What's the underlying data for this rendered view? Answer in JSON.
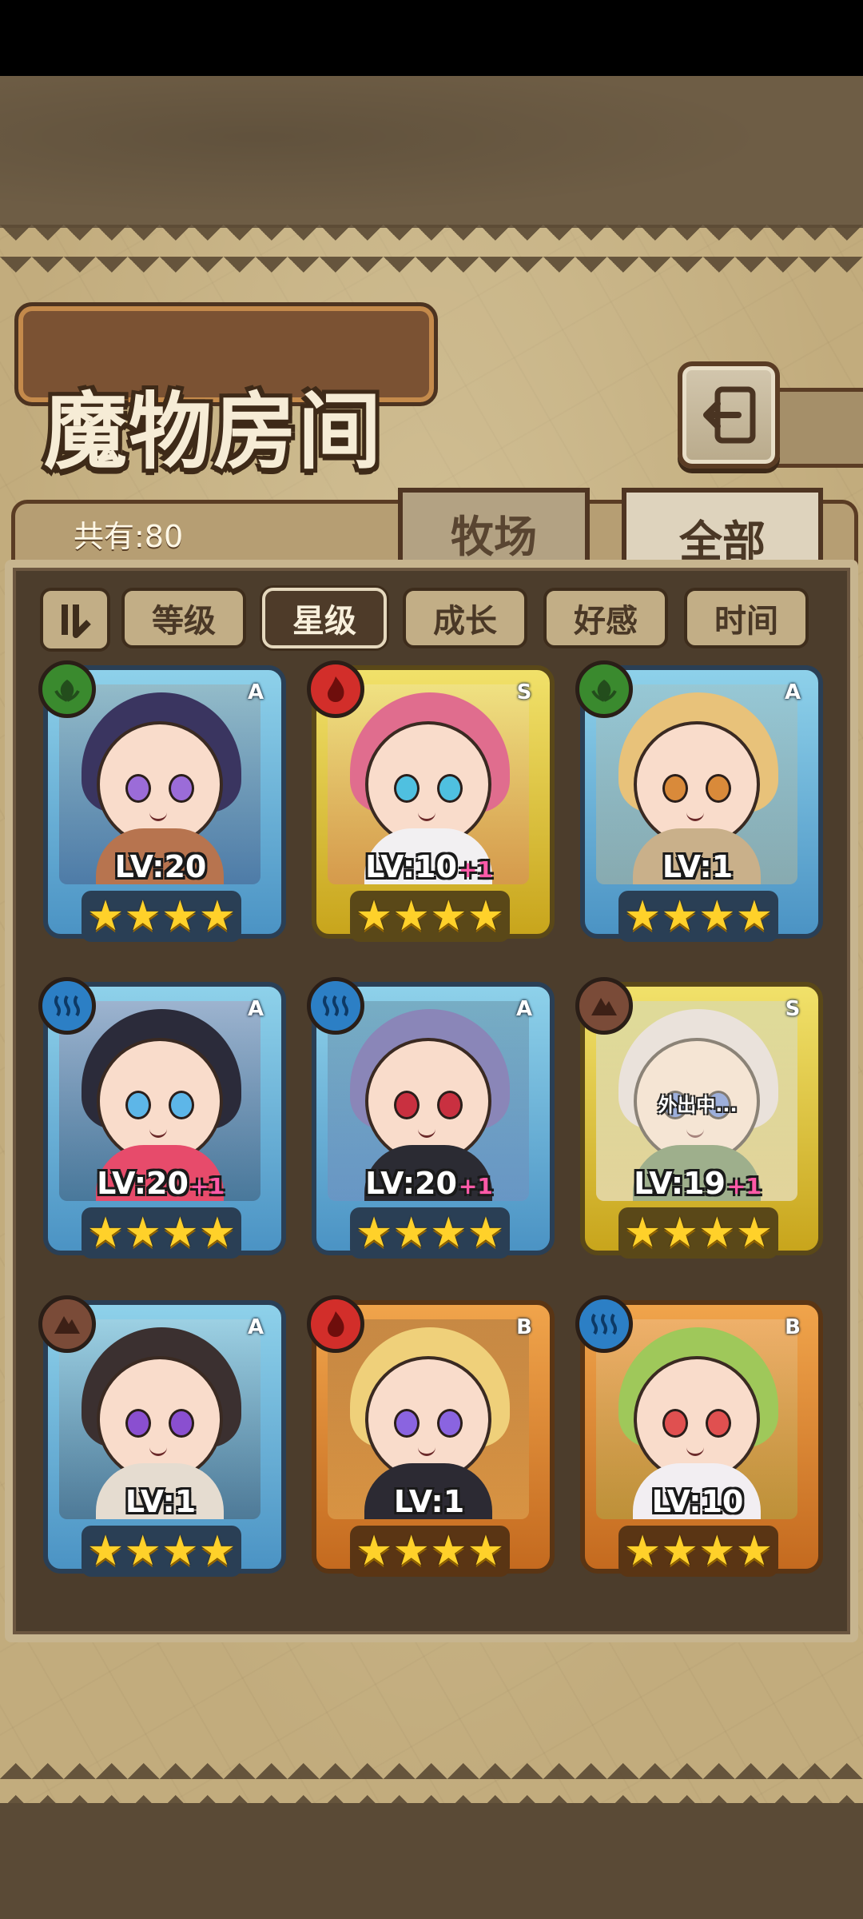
{
  "title": "魔物房间",
  "total_count": "共有:80",
  "tabs": [
    {
      "label": "牧场",
      "active": false
    },
    {
      "label": "全部",
      "active": true
    }
  ],
  "sort_buttons": [
    {
      "label": "等级",
      "active": false
    },
    {
      "label": "星级",
      "active": true
    },
    {
      "label": "成长",
      "active": false
    },
    {
      "label": "好感",
      "active": false
    },
    {
      "label": "时间",
      "active": false
    }
  ],
  "colors": {
    "tier_A": "#4b93c4",
    "tier_S": "#c8a51c",
    "tier_B": "#c46a1f",
    "star": "#ffd12a",
    "bonus_text": "#ff5aa8"
  },
  "monsters": [
    {
      "element": "leaf",
      "rank": "A",
      "level": "LV:20",
      "bonus": "",
      "stars": 4,
      "status": ""
    },
    {
      "element": "fire",
      "rank": "S",
      "level": "LV:10",
      "bonus": "+1",
      "stars": 4,
      "status": ""
    },
    {
      "element": "leaf",
      "rank": "A",
      "level": "LV:1",
      "bonus": "",
      "stars": 4,
      "status": ""
    },
    {
      "element": "water",
      "rank": "A",
      "level": "LV:20",
      "bonus": "+1",
      "stars": 4,
      "status": ""
    },
    {
      "element": "water",
      "rank": "A",
      "level": "LV:20",
      "bonus": "+1",
      "stars": 4,
      "status": ""
    },
    {
      "element": "rock",
      "rank": "S",
      "level": "LV:19",
      "bonus": "+1",
      "stars": 4,
      "status": "外出中..."
    },
    {
      "element": "rock",
      "rank": "A",
      "level": "LV:1",
      "bonus": "",
      "stars": 4,
      "status": ""
    },
    {
      "element": "fire",
      "rank": "B",
      "level": "LV:1",
      "bonus": "",
      "stars": 4,
      "status": ""
    },
    {
      "element": "water",
      "rank": "B",
      "level": "LV:10",
      "bonus": "",
      "stars": 4,
      "status": ""
    }
  ]
}
